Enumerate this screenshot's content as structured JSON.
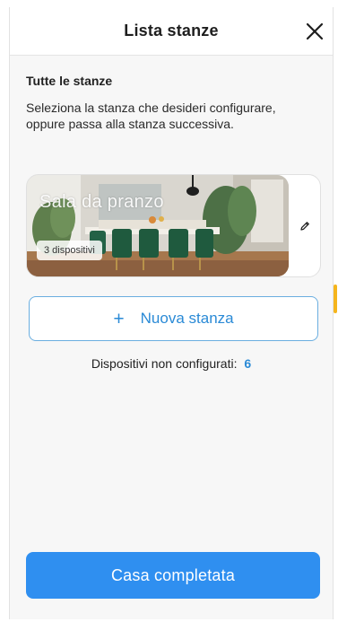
{
  "header": {
    "title": "Lista stanze",
    "close_icon": "close-icon"
  },
  "section": {
    "title": "Tutte le stanze",
    "description": "Seleziona la stanza che desideri configurare, oppure passa alla stanza successiva."
  },
  "rooms": [
    {
      "name": "Sala da pranzo",
      "devices_label": "3 dispositivi",
      "edit_icon": "pencil-icon"
    }
  ],
  "new_room": {
    "icon": "plus-icon",
    "label": "Nuova stanza"
  },
  "unconfigured": {
    "label": "Dispositivi non configurati:",
    "count": "6"
  },
  "footer": {
    "complete_label": "Casa completata"
  },
  "colors": {
    "accent": "#2f8ff0",
    "link": "#2a8ad6",
    "scroll": "#f5b51c"
  }
}
